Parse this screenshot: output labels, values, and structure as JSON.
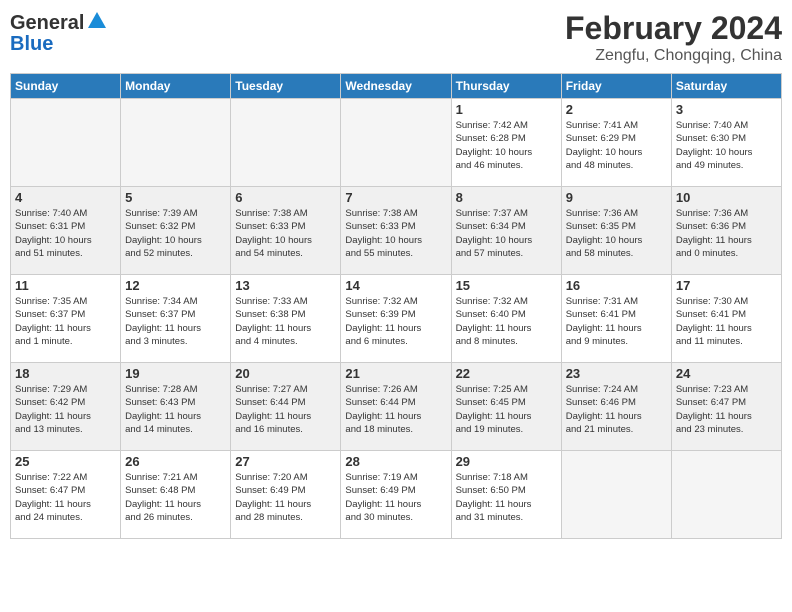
{
  "header": {
    "logo_general": "General",
    "logo_blue": "Blue",
    "title": "February 2024",
    "subtitle": "Zengfu, Chongqing, China"
  },
  "weekdays": [
    "Sunday",
    "Monday",
    "Tuesday",
    "Wednesday",
    "Thursday",
    "Friday",
    "Saturday"
  ],
  "weeks": [
    [
      {
        "day": "",
        "info": ""
      },
      {
        "day": "",
        "info": ""
      },
      {
        "day": "",
        "info": ""
      },
      {
        "day": "",
        "info": ""
      },
      {
        "day": "1",
        "info": "Sunrise: 7:42 AM\nSunset: 6:28 PM\nDaylight: 10 hours\nand 46 minutes."
      },
      {
        "day": "2",
        "info": "Sunrise: 7:41 AM\nSunset: 6:29 PM\nDaylight: 10 hours\nand 48 minutes."
      },
      {
        "day": "3",
        "info": "Sunrise: 7:40 AM\nSunset: 6:30 PM\nDaylight: 10 hours\nand 49 minutes."
      }
    ],
    [
      {
        "day": "4",
        "info": "Sunrise: 7:40 AM\nSunset: 6:31 PM\nDaylight: 10 hours\nand 51 minutes."
      },
      {
        "day": "5",
        "info": "Sunrise: 7:39 AM\nSunset: 6:32 PM\nDaylight: 10 hours\nand 52 minutes."
      },
      {
        "day": "6",
        "info": "Sunrise: 7:38 AM\nSunset: 6:33 PM\nDaylight: 10 hours\nand 54 minutes."
      },
      {
        "day": "7",
        "info": "Sunrise: 7:38 AM\nSunset: 6:33 PM\nDaylight: 10 hours\nand 55 minutes."
      },
      {
        "day": "8",
        "info": "Sunrise: 7:37 AM\nSunset: 6:34 PM\nDaylight: 10 hours\nand 57 minutes."
      },
      {
        "day": "9",
        "info": "Sunrise: 7:36 AM\nSunset: 6:35 PM\nDaylight: 10 hours\nand 58 minutes."
      },
      {
        "day": "10",
        "info": "Sunrise: 7:36 AM\nSunset: 6:36 PM\nDaylight: 11 hours\nand 0 minutes."
      }
    ],
    [
      {
        "day": "11",
        "info": "Sunrise: 7:35 AM\nSunset: 6:37 PM\nDaylight: 11 hours\nand 1 minute."
      },
      {
        "day": "12",
        "info": "Sunrise: 7:34 AM\nSunset: 6:37 PM\nDaylight: 11 hours\nand 3 minutes."
      },
      {
        "day": "13",
        "info": "Sunrise: 7:33 AM\nSunset: 6:38 PM\nDaylight: 11 hours\nand 4 minutes."
      },
      {
        "day": "14",
        "info": "Sunrise: 7:32 AM\nSunset: 6:39 PM\nDaylight: 11 hours\nand 6 minutes."
      },
      {
        "day": "15",
        "info": "Sunrise: 7:32 AM\nSunset: 6:40 PM\nDaylight: 11 hours\nand 8 minutes."
      },
      {
        "day": "16",
        "info": "Sunrise: 7:31 AM\nSunset: 6:41 PM\nDaylight: 11 hours\nand 9 minutes."
      },
      {
        "day": "17",
        "info": "Sunrise: 7:30 AM\nSunset: 6:41 PM\nDaylight: 11 hours\nand 11 minutes."
      }
    ],
    [
      {
        "day": "18",
        "info": "Sunrise: 7:29 AM\nSunset: 6:42 PM\nDaylight: 11 hours\nand 13 minutes."
      },
      {
        "day": "19",
        "info": "Sunrise: 7:28 AM\nSunset: 6:43 PM\nDaylight: 11 hours\nand 14 minutes."
      },
      {
        "day": "20",
        "info": "Sunrise: 7:27 AM\nSunset: 6:44 PM\nDaylight: 11 hours\nand 16 minutes."
      },
      {
        "day": "21",
        "info": "Sunrise: 7:26 AM\nSunset: 6:44 PM\nDaylight: 11 hours\nand 18 minutes."
      },
      {
        "day": "22",
        "info": "Sunrise: 7:25 AM\nSunset: 6:45 PM\nDaylight: 11 hours\nand 19 minutes."
      },
      {
        "day": "23",
        "info": "Sunrise: 7:24 AM\nSunset: 6:46 PM\nDaylight: 11 hours\nand 21 minutes."
      },
      {
        "day": "24",
        "info": "Sunrise: 7:23 AM\nSunset: 6:47 PM\nDaylight: 11 hours\nand 23 minutes."
      }
    ],
    [
      {
        "day": "25",
        "info": "Sunrise: 7:22 AM\nSunset: 6:47 PM\nDaylight: 11 hours\nand 24 minutes."
      },
      {
        "day": "26",
        "info": "Sunrise: 7:21 AM\nSunset: 6:48 PM\nDaylight: 11 hours\nand 26 minutes."
      },
      {
        "day": "27",
        "info": "Sunrise: 7:20 AM\nSunset: 6:49 PM\nDaylight: 11 hours\nand 28 minutes."
      },
      {
        "day": "28",
        "info": "Sunrise: 7:19 AM\nSunset: 6:49 PM\nDaylight: 11 hours\nand 30 minutes."
      },
      {
        "day": "29",
        "info": "Sunrise: 7:18 AM\nSunset: 6:50 PM\nDaylight: 11 hours\nand 31 minutes."
      },
      {
        "day": "",
        "info": ""
      },
      {
        "day": "",
        "info": ""
      }
    ]
  ]
}
